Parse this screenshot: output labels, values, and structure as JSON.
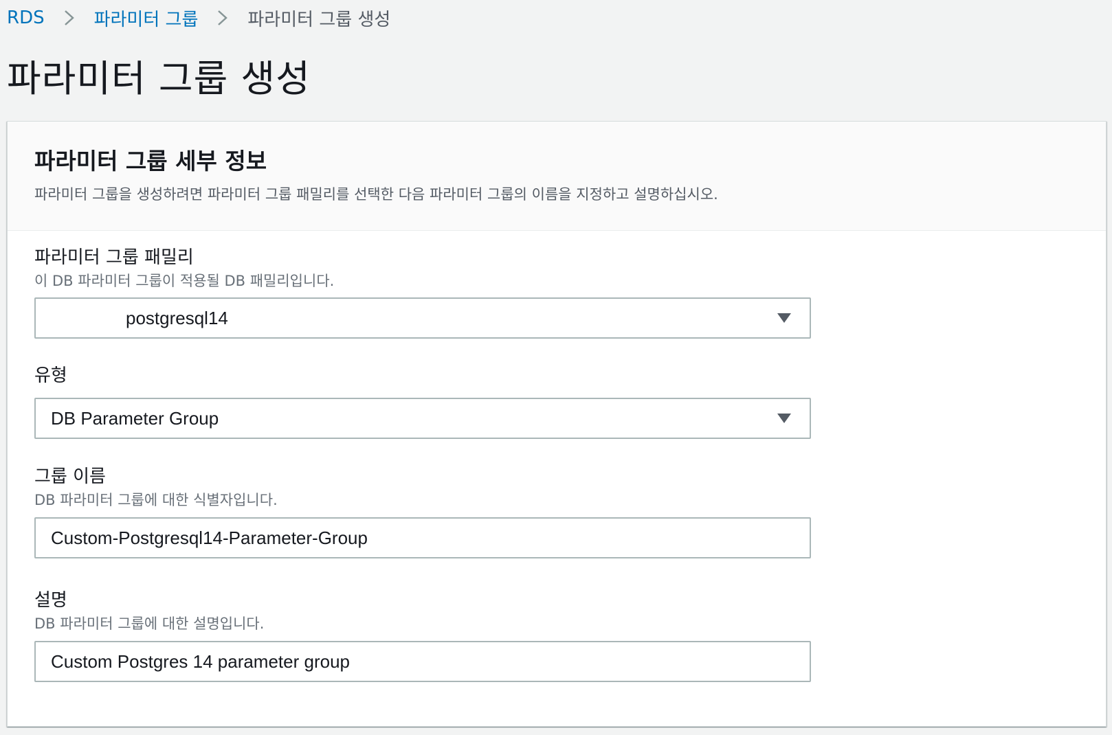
{
  "breadcrumb": {
    "items": [
      {
        "label": "RDS",
        "link": true
      },
      {
        "label": "파라미터 그룹",
        "link": true
      },
      {
        "label": "파라미터 그룹 생성",
        "link": false
      }
    ]
  },
  "page": {
    "title": "파라미터 그룹 생성"
  },
  "panel": {
    "title": "파라미터 그룹 세부 정보",
    "description": "파라미터 그룹을 생성하려면 파라미터 그룹 패밀리를 선택한 다음 파라미터 그룹의 이름을 지정하고 설명하십시오."
  },
  "fields": {
    "family": {
      "label": "파라미터 그룹 패밀리",
      "description": "이 DB 파라미터 그룹이 적용될 DB 패밀리입니다.",
      "value": "postgresql14"
    },
    "type": {
      "label": "유형",
      "value": "DB Parameter Group"
    },
    "group_name": {
      "label": "그룹 이름",
      "description": "DB 파라미터 그룹에 대한 식별자입니다.",
      "value": "Custom-Postgresql14-Parameter-Group"
    },
    "description": {
      "label": "설명",
      "description": "DB 파라미터 그룹에 대한 설명입니다.",
      "value": "Custom Postgres 14 parameter group"
    }
  },
  "colors": {
    "link": "#0073bb",
    "text": "#16191f",
    "secondary_text": "#687078",
    "border": "#aab7b8",
    "page_bg": "#f2f3f3"
  },
  "icons": {
    "breadcrumb_separator": "chevron-right-icon",
    "select_caret": "caret-down-icon"
  }
}
